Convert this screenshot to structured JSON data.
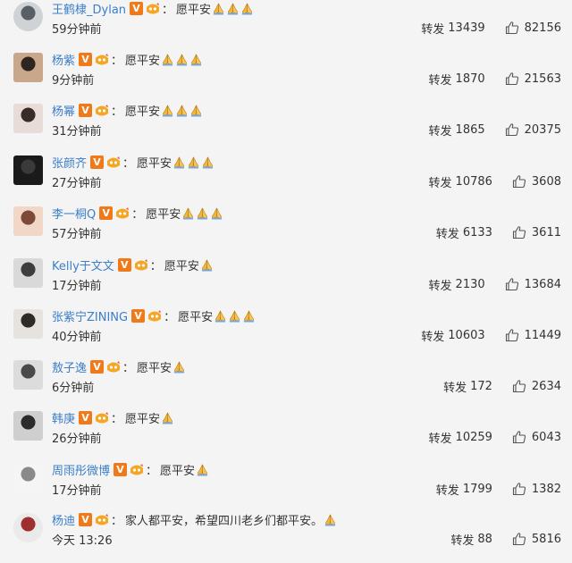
{
  "retweet_label": "转发",
  "colon": "：",
  "comments": [
    {
      "name": "王鹤棣_Dylan",
      "message": "愿平安",
      "prayers": 3,
      "time": "59分钟前",
      "reposts": "13439",
      "likes": "82156",
      "avatar_colors": [
        "#cfd3d6",
        "#5a5f66"
      ]
    },
    {
      "name": "杨紫",
      "message": "愿平安",
      "prayers": 3,
      "time": "9分钟前",
      "reposts": "1870",
      "likes": "21563",
      "avatar_colors": [
        "#c9a78a",
        "#2e2520"
      ]
    },
    {
      "name": "杨幂",
      "message": "愿平安",
      "prayers": 3,
      "time": "31分钟前",
      "reposts": "1865",
      "likes": "20375",
      "avatar_colors": [
        "#e7dcd8",
        "#3a2a2a"
      ]
    },
    {
      "name": "张颜齐",
      "message": "愿平安",
      "prayers": 3,
      "time": "27分钟前",
      "reposts": "10786",
      "likes": "3608",
      "avatar_colors": [
        "#1a1a1a",
        "#3a3a3a"
      ]
    },
    {
      "name": "李一桐Q",
      "message": "愿平安",
      "prayers": 3,
      "time": "57分钟前",
      "reposts": "6133",
      "likes": "3611",
      "avatar_colors": [
        "#f2d7c6",
        "#7d4a3a"
      ]
    },
    {
      "name": "Kelly于文文",
      "message": "愿平安",
      "prayers": 1,
      "time": "17分钟前",
      "reposts": "2130",
      "likes": "13684",
      "avatar_colors": [
        "#d9d9d9",
        "#3d3d3d"
      ]
    },
    {
      "name": "张紫宁ZINING",
      "message": "愿平安",
      "prayers": 3,
      "time": "40分钟前",
      "reposts": "10603",
      "likes": "11449",
      "avatar_colors": [
        "#e6e2de",
        "#2e2a28"
      ]
    },
    {
      "name": "敖子逸",
      "message": "愿平安",
      "prayers": 1,
      "time": "6分钟前",
      "reposts": "172",
      "likes": "2634",
      "avatar_colors": [
        "#dcdcdc",
        "#4a4a4a"
      ]
    },
    {
      "name": "韩庚",
      "message": "愿平安",
      "prayers": 1,
      "time": "26分钟前",
      "reposts": "10259",
      "likes": "6043",
      "avatar_colors": [
        "#cfcfcf",
        "#2c2c2c"
      ]
    },
    {
      "name": "周雨彤微博",
      "message": "愿平安",
      "prayers": 1,
      "time": "17分钟前",
      "reposts": "1799",
      "likes": "1382",
      "avatar_colors": [
        "#f5f5f5",
        "#8a8a8a"
      ]
    },
    {
      "name": "杨迪",
      "message": "家人都平安，希望四川老乡们都平安。",
      "prayers": 1,
      "time": "今天 13:26",
      "reposts": "88",
      "likes": "5816",
      "avatar_colors": [
        "#eaeaea",
        "#a03030"
      ]
    }
  ],
  "colors": {
    "username": "#3b7ec9",
    "vbadge": "#f07a1a",
    "level_icon": "#f5a623",
    "background": "#f4f4f4"
  },
  "icons": [
    "v-badge-icon",
    "level-icon",
    "prayer-hands-icon",
    "thumbs-up-icon"
  ]
}
